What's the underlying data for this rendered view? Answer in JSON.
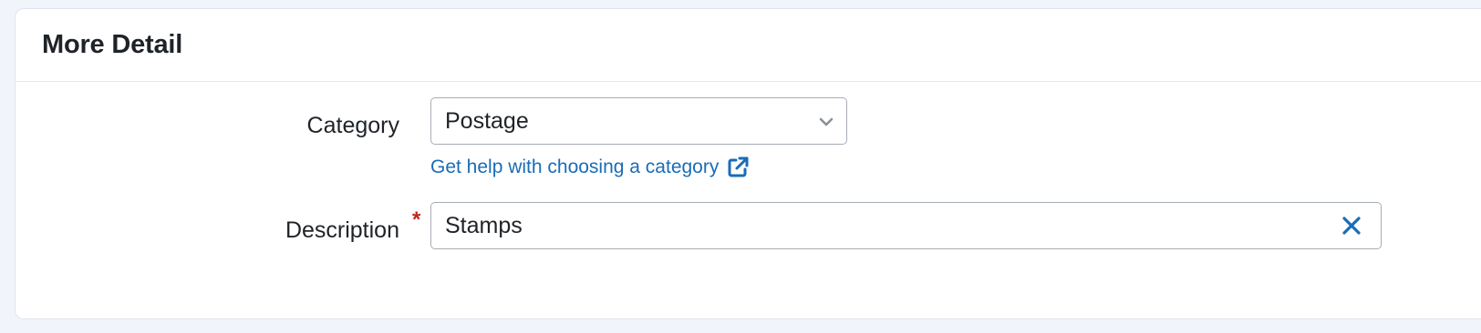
{
  "section": {
    "title": "More Detail"
  },
  "form": {
    "category": {
      "label": "Category",
      "selected_value": "Postage",
      "help_link_text": "Get help with choosing a category"
    },
    "description": {
      "label": "Description",
      "required_marker": "*",
      "value": "Stamps"
    }
  },
  "icons": {
    "select_arrow": "chevron-down-icon",
    "help_link": "external-link-icon",
    "clear": "close-icon"
  },
  "colors": {
    "link": "#1a6cb7",
    "required": "#c0281c",
    "clear_icon": "#1a6cb7"
  }
}
